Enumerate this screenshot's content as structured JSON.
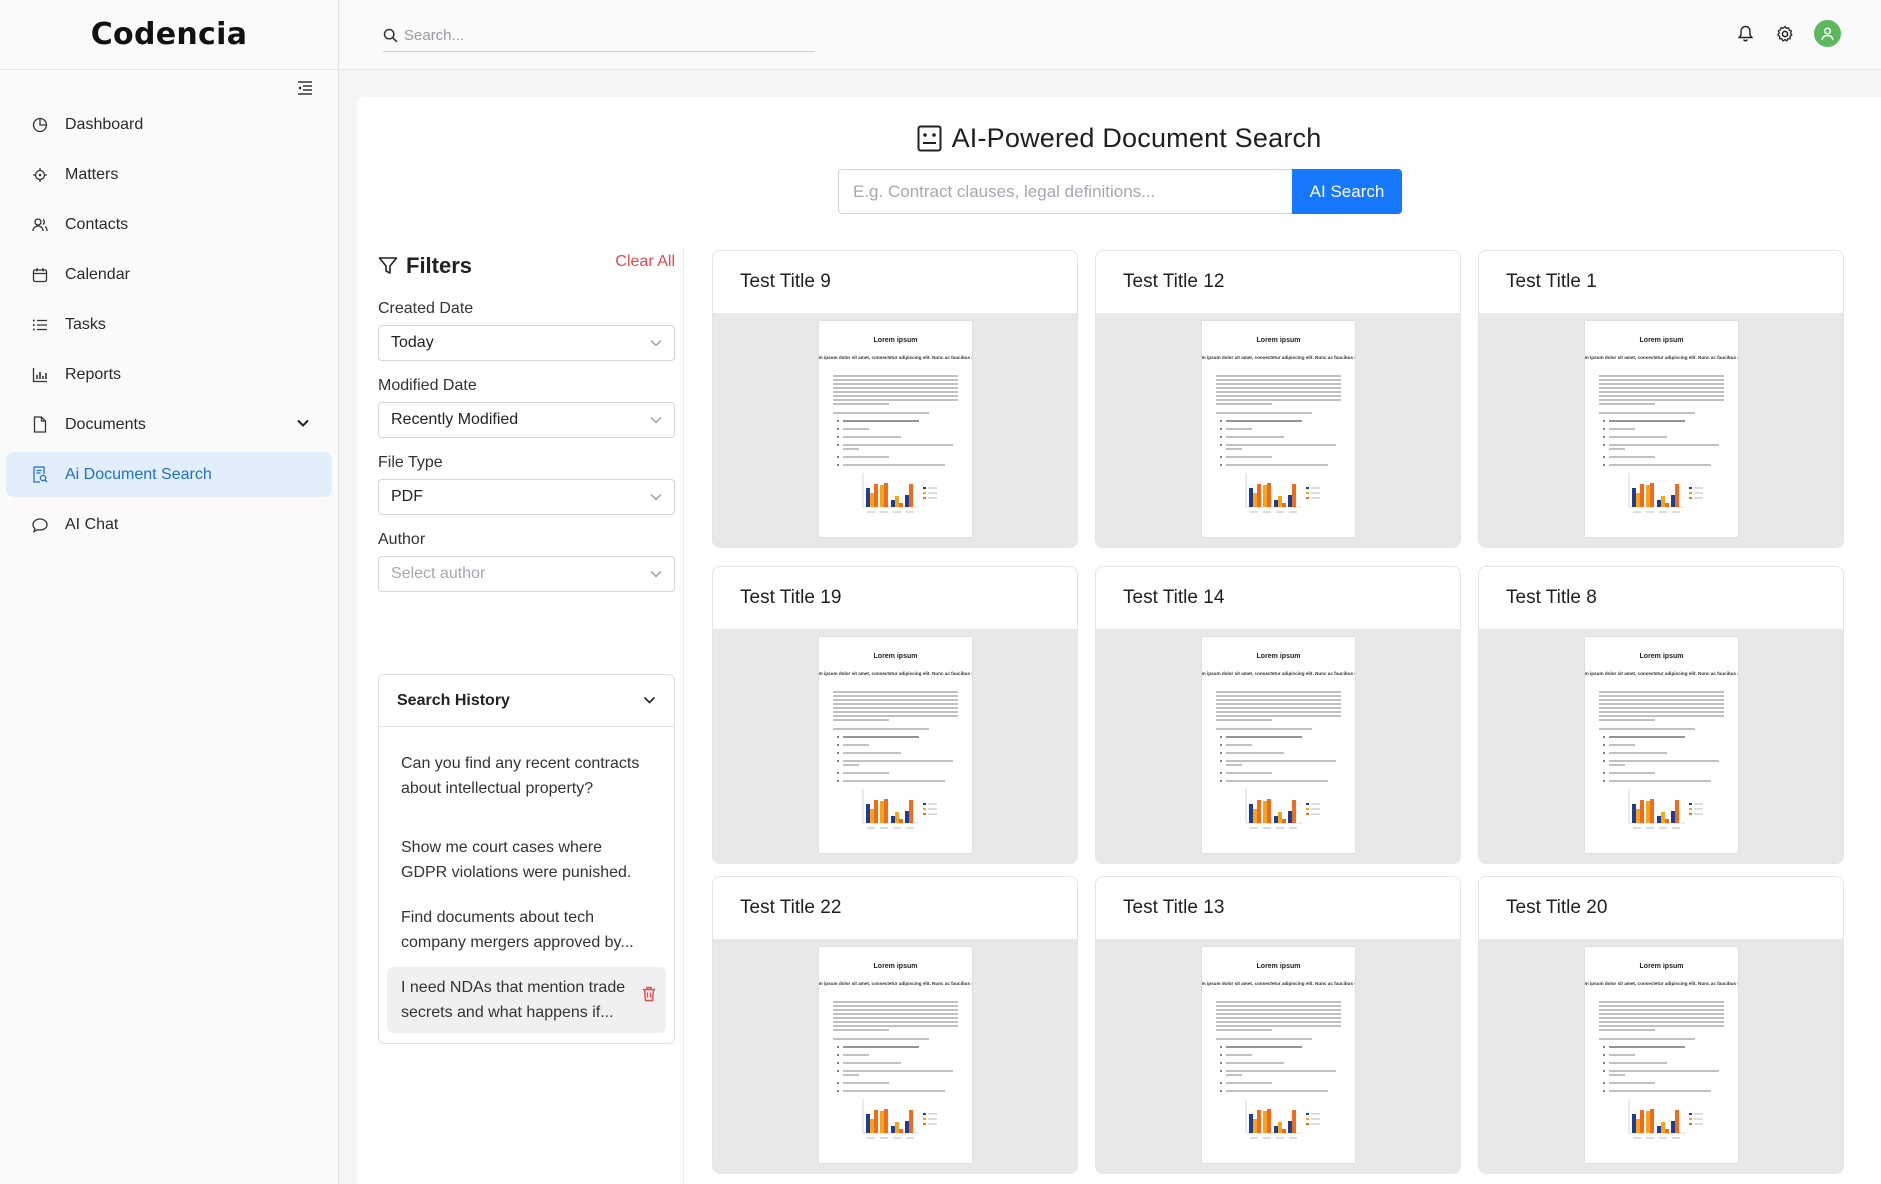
{
  "app": {
    "brand": "Codencia"
  },
  "header": {
    "search_placeholder": "Search..."
  },
  "sidebar": {
    "items": [
      {
        "label": "Dashboard",
        "icon": "pie-chart-icon"
      },
      {
        "label": "Matters",
        "icon": "target-icon"
      },
      {
        "label": "Contacts",
        "icon": "users-icon"
      },
      {
        "label": "Calendar",
        "icon": "calendar-icon"
      },
      {
        "label": "Tasks",
        "icon": "list-icon"
      },
      {
        "label": "Reports",
        "icon": "bar-chart-icon"
      },
      {
        "label": "Documents",
        "icon": "file-icon",
        "expandable": true
      },
      {
        "label": "Ai Document Search",
        "icon": "doc-search-icon",
        "active": true
      },
      {
        "label": "AI Chat",
        "icon": "chat-icon"
      }
    ]
  },
  "page": {
    "title": "AI-Powered Document Search",
    "search_placeholder": "E.g. Contract clauses, legal definitions...",
    "search_button": "AI Search"
  },
  "filters": {
    "title": "Filters",
    "clear_all": "Clear All",
    "created_date": {
      "label": "Created Date",
      "value": "Today"
    },
    "modified_date": {
      "label": "Modified Date",
      "value": "Recently Modified"
    },
    "file_type": {
      "label": "File Type",
      "value": "PDF"
    },
    "author": {
      "label": "Author",
      "placeholder": "Select author"
    }
  },
  "history": {
    "title": "Search History",
    "items": [
      "Can you find any recent contracts about intellectual property?",
      "Show me court cases where GDPR violations were punished.",
      "Find documents about tech company mergers approved by...",
      "I need NDAs that mention trade secrets and what happens if..."
    ]
  },
  "documents": [
    {
      "title": "Test Title 9"
    },
    {
      "title": "Test Title 12"
    },
    {
      "title": "Test Title 1"
    },
    {
      "title": "Test Title 19"
    },
    {
      "title": "Test Title 14"
    },
    {
      "title": "Test Title 8"
    },
    {
      "title": "Test Title 22"
    },
    {
      "title": "Test Title 13"
    },
    {
      "title": "Test Title 20"
    }
  ],
  "thumbnail": {
    "heading": "Lorem ipsum",
    "subheading": "Lorem ipsum dolor sit amet, consectetur adipiscing elit. Nunc ac faucibus odio."
  },
  "colors": {
    "accent": "#1677ff",
    "active_bg": "#e3eefb",
    "danger": "#e5484d",
    "avatar": "#5cb85c"
  }
}
